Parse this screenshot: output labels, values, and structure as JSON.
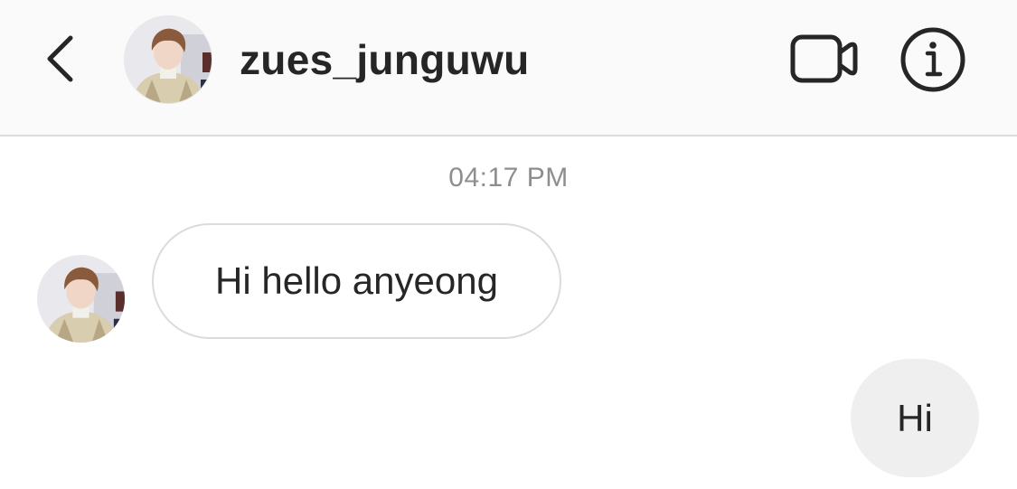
{
  "header": {
    "username": "zues_junguwu",
    "back_icon": "chevron-left-icon",
    "video_icon": "video-camera-icon",
    "info_icon": "info-icon"
  },
  "conversation": {
    "timestamp": "04:17 PM",
    "messages": [
      {
        "direction": "incoming",
        "text": "Hi hello anyeong"
      },
      {
        "direction": "outgoing",
        "text": "Hi"
      }
    ]
  },
  "colors": {
    "header_bg": "#fafafa",
    "text_primary": "#262626",
    "text_secondary": "#8e8e8e",
    "outgoing_bubble": "#efefef",
    "incoming_border": "#dbdbdb"
  }
}
